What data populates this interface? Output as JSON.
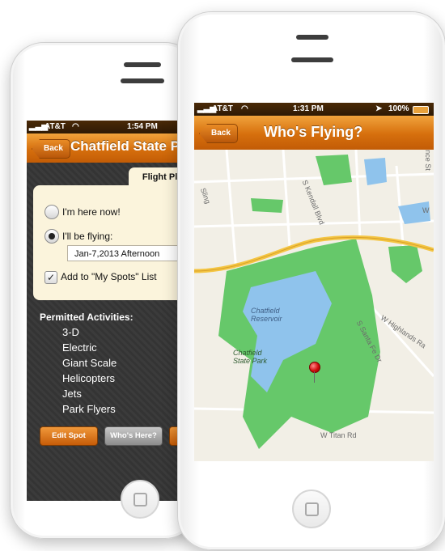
{
  "back_phone": {
    "status": {
      "carrier": "AT&T",
      "time": "1:54 PM"
    },
    "nav": {
      "back_label": "Back",
      "title": "Chatfield State P"
    },
    "tab": {
      "label": "Flight Plan"
    },
    "options": {
      "here_now": "I'm here now!",
      "will_fly": "I'll be flying:",
      "date_value": "Jan-7,2013 Afternoon",
      "add_spots": "Add to \"My Spots\" List",
      "check_mark": "✓"
    },
    "activities": {
      "title": "Permitted Activities:",
      "items": [
        "3-D",
        "Electric",
        "Giant Scale",
        "Helicopters",
        "Jets",
        "Park Flyers"
      ]
    },
    "buttons": {
      "edit_spot": "Edit Spot",
      "whos_here": "Who's Here?"
    }
  },
  "front_phone": {
    "status": {
      "carrier": "AT&T",
      "time": "1:31 PM",
      "battery": "100%"
    },
    "nav": {
      "back_label": "Back",
      "title": "Who's Flying?"
    },
    "map": {
      "labels": {
        "reservoir": "Chatfield\nReservoir",
        "park": "Chatfield\nState Park",
        "kendall": "S Kendall Blvd",
        "titan": "W Titan Rd",
        "santafe": "S Santa Fe Dr",
        "highlands": "W Highlands Ra",
        "sling": "Sling",
        "ncest": "nce St",
        "w": "W"
      }
    }
  },
  "colors": {
    "nav_orange": "#d66f0d",
    "status_brown": "#3b2106",
    "park_green": "#66c86a",
    "water_blue": "#8fc3ec",
    "highway_yellow": "#f4c542"
  },
  "icons": [
    "signal-icon",
    "wifi-icon",
    "location-arrow-icon",
    "battery-icon",
    "map-pin-icon",
    "checkbox-check-icon"
  ]
}
